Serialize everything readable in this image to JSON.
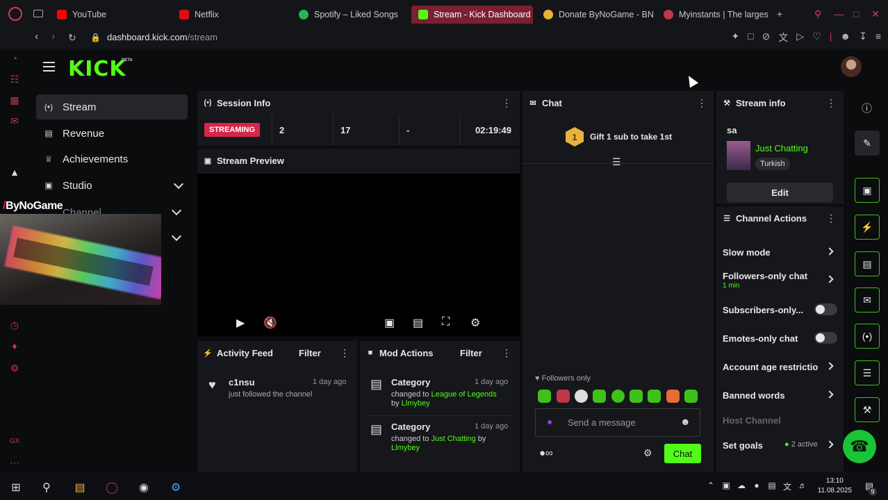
{
  "browser": {
    "tabs": [
      {
        "label": "YouTube",
        "icon": "youtube-icon",
        "color": "#ff0000"
      },
      {
        "label": "Netflix",
        "icon": "netflix-icon",
        "color": "#e50914"
      },
      {
        "label": "Spotify – Liked Songs",
        "icon": "spotify-icon",
        "color": "#1db954"
      },
      {
        "label": "Stream - Kick Dashboard",
        "icon": "kick-icon",
        "color": "#53fc18"
      },
      {
        "label": "Donate ByNoGame - BN",
        "icon": "bynogame-icon",
        "color": "#e8b33a"
      },
      {
        "label": "Myinstants | The largest",
        "icon": "myinstants-icon",
        "color": "#c0364a"
      }
    ],
    "url_host": "dashboard.kick.com",
    "url_path": "/stream"
  },
  "kick": {
    "logo": "KICK",
    "beta": "BETA",
    "nav": [
      {
        "label": "Stream",
        "icon": "broadcast-icon",
        "active": true
      },
      {
        "label": "Revenue",
        "icon": "revenue-icon",
        "active": false
      },
      {
        "label": "Achievements",
        "icon": "trophy-icon",
        "active": false
      },
      {
        "label": "Studio",
        "icon": "studio-icon",
        "active": false
      },
      {
        "label": "Channel",
        "icon": "channel-icon",
        "active": false
      }
    ],
    "accent": "#53fc18"
  },
  "webcam": {
    "overlay_text": "ByNoGame"
  },
  "session": {
    "title": "Session Info",
    "status": "STREAMING",
    "viewers": "2",
    "followers": "17",
    "subs": "-",
    "duration": "02:19:49"
  },
  "preview": {
    "title": "Stream Preview"
  },
  "activity": {
    "title": "Activity Feed",
    "filter": "Filter",
    "items": [
      {
        "name": "c1nsu",
        "text": "just followed the channel",
        "ago": "1 day ago"
      }
    ]
  },
  "mod": {
    "title": "Mod Actions",
    "filter": "Filter",
    "items": [
      {
        "title": "Category",
        "ago": "1 day ago",
        "prefix": "changed to",
        "target": "League of Legends",
        "by": "by",
        "user": "Llmybey"
      },
      {
        "title": "Category",
        "ago": "1 day ago",
        "prefix": "changed to",
        "target": "Just Chatting",
        "by": "by",
        "user": "Llmybey"
      }
    ]
  },
  "chat": {
    "title": "Chat",
    "gift_rank": "1",
    "gift_text": "Gift 1 sub to take 1st",
    "followers_only": "Followers only",
    "placeholder": "Send a message",
    "send": "Chat"
  },
  "stream_info": {
    "title": "Stream info",
    "stream_title": "sa",
    "category": "Just Chatting",
    "language": "Turkish",
    "edit": "Edit"
  },
  "channel_actions": {
    "title": "Channel Actions",
    "slow_mode": "Slow mode",
    "followers_only": "Followers-only chat",
    "followers_only_value": "1 min",
    "subscribers_only": "Subscribers-only...",
    "emotes_only": "Emotes-only chat",
    "account_age": "Account age restrictio",
    "banned_words": "Banned words",
    "host_channel": "Host Channel",
    "set_goals": "Set goals",
    "goals_active": "2 active"
  },
  "taskbar": {
    "time": "13:10",
    "date": "11.08.2025",
    "notifications": "9"
  }
}
